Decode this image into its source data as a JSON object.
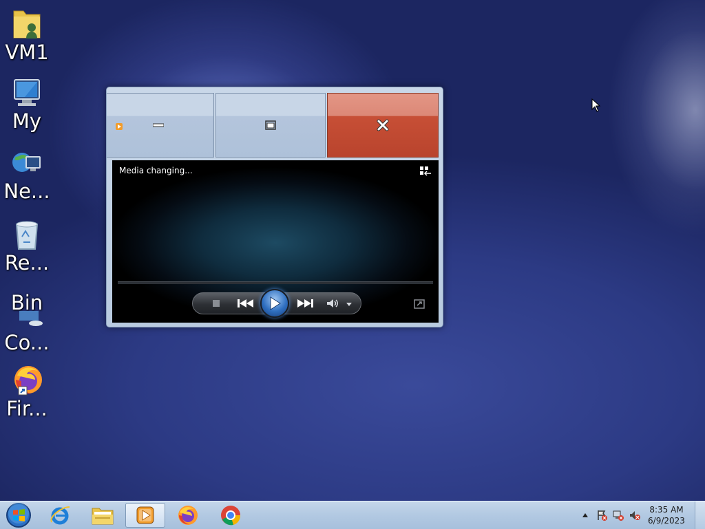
{
  "desktop": {
    "icons": [
      {
        "label": "VM1",
        "icon": "user-folder-icon"
      },
      {
        "label": "My",
        "icon": "computer-icon"
      },
      {
        "label": "Ne...",
        "icon": "network-icon"
      },
      {
        "label": "Re...",
        "icon": "recycle-bin-icon"
      },
      {
        "label": "Bin",
        "icon": "control-panel-icon"
      },
      {
        "label": "Co...",
        "icon": ""
      },
      {
        "label": "Fir...",
        "icon": "firefox-icon"
      }
    ]
  },
  "player": {
    "window_caption_buttons": [
      "minimize",
      "maximize",
      "close"
    ],
    "status_text": "Media changing...",
    "controls": [
      "stop",
      "previous",
      "play",
      "next",
      "volume"
    ]
  },
  "taskbar": {
    "pinned": [
      "start-button",
      "internet-explorer",
      "windows-explorer",
      "windows-media-player",
      "firefox",
      "chrome"
    ],
    "clock_time": "8:35 AM",
    "clock_date": "6/9/2023"
  },
  "colors": {
    "close_button": "#c74f36",
    "taskbar": "#b2c9e2",
    "play_button": "#2f6fc0"
  }
}
